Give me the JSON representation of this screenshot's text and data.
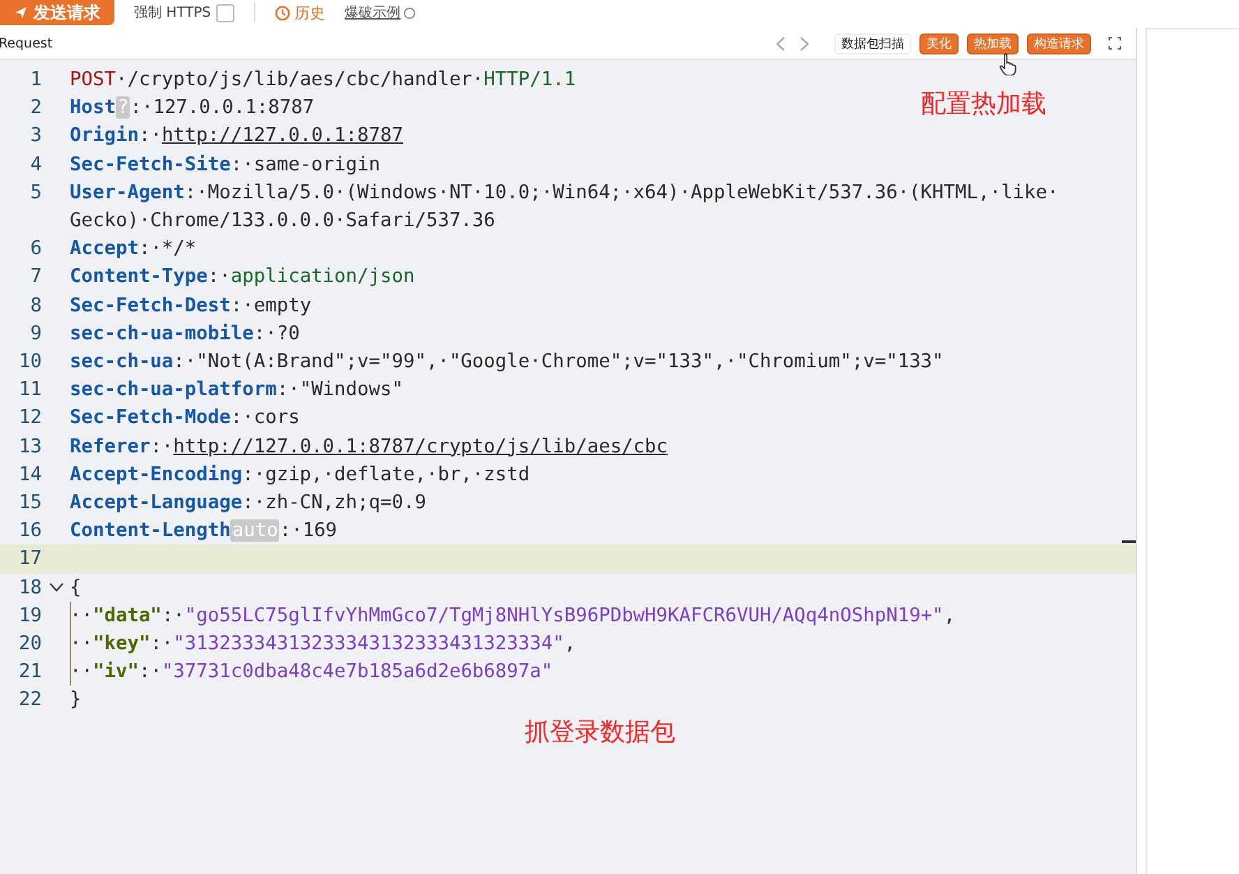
{
  "top_toolbar": {
    "send_button": "发送请求",
    "force_https": {
      "label": "强制 HTTPS",
      "checked": false
    },
    "history": "历史",
    "example_link": "爆破示例"
  },
  "panel_title": "Request",
  "toolbar_buttons": [
    {
      "label": "数据包扫描",
      "kind": "plain"
    },
    {
      "label": "美化",
      "kind": "accent"
    },
    {
      "label": "热加载",
      "kind": "accent"
    },
    {
      "label": "构造请求",
      "kind": "accent"
    }
  ],
  "lines": [
    {
      "number": "1",
      "current": false,
      "foldable": false,
      "guide": false,
      "tokens": [
        {
          "kind": "method",
          "text": "POST"
        },
        {
          "kind": "plain",
          "text": "·/crypto/js/lib/aes/cbc/handler·"
        },
        {
          "kind": "version",
          "text": "HTTP/1.1"
        }
      ]
    },
    {
      "number": "2",
      "current": false,
      "foldable": false,
      "guide": false,
      "tokens": [
        {
          "kind": "header",
          "text": "Host"
        },
        {
          "kind": "badge",
          "text": "?"
        },
        {
          "kind": "plain",
          "text": ":·127.0.0.1:8787"
        }
      ]
    },
    {
      "number": "3",
      "current": false,
      "foldable": false,
      "guide": false,
      "tokens": [
        {
          "kind": "header",
          "text": "Origin"
        },
        {
          "kind": "plain",
          "text": ":·"
        },
        {
          "kind": "url",
          "text": "http://127.0.0.1:8787"
        }
      ]
    },
    {
      "number": "4",
      "current": false,
      "foldable": false,
      "guide": false,
      "tokens": [
        {
          "kind": "header",
          "text": "Sec-Fetch-Site"
        },
        {
          "kind": "plain",
          "text": ":·same-origin"
        }
      ]
    },
    {
      "number": "5",
      "current": false,
      "foldable": false,
      "guide": false,
      "tokens": [
        {
          "kind": "header",
          "text": "User-Agent"
        },
        {
          "kind": "plain",
          "text": ":·Mozilla/5.0·(Windows·NT·10.0;·Win64;·x64)·AppleWebKit/537.36·(KHTML,·like· Gecko)·Chrome/133.0.0.0·Safari/537.36"
        }
      ]
    },
    {
      "number": "6",
      "current": false,
      "foldable": false,
      "guide": false,
      "tokens": [
        {
          "kind": "header",
          "text": "Accept"
        },
        {
          "kind": "plain",
          "text": ":·*/*"
        }
      ]
    },
    {
      "number": "7",
      "current": false,
      "foldable": false,
      "guide": false,
      "tokens": [
        {
          "kind": "header",
          "text": "Content-Type"
        },
        {
          "kind": "plain",
          "text": ":·"
        },
        {
          "kind": "version",
          "text": "application/json"
        }
      ]
    },
    {
      "number": "8",
      "current": false,
      "foldable": false,
      "guide": false,
      "tokens": [
        {
          "kind": "header",
          "text": "Sec-Fetch-Dest"
        },
        {
          "kind": "plain",
          "text": ":·empty"
        }
      ]
    },
    {
      "number": "9",
      "current": false,
      "foldable": false,
      "guide": false,
      "tokens": [
        {
          "kind": "header",
          "text": "sec-ch-ua-mobile"
        },
        {
          "kind": "plain",
          "text": ":·?0"
        }
      ]
    },
    {
      "number": "10",
      "current": false,
      "foldable": false,
      "guide": false,
      "tokens": [
        {
          "kind": "header",
          "text": "sec-ch-ua"
        },
        {
          "kind": "plain",
          "text": ":·\"Not(A:Brand\";v=\"99\",·\"Google·Chrome\";v=\"133\",·\"Chromium\";v=\"133\""
        }
      ]
    },
    {
      "number": "11",
      "current": false,
      "foldable": false,
      "guide": false,
      "tokens": [
        {
          "kind": "header",
          "text": "sec-ch-ua-platform"
        },
        {
          "kind": "plain",
          "text": ":·\"Windows\""
        }
      ]
    },
    {
      "number": "12",
      "current": false,
      "foldable": false,
      "guide": false,
      "tokens": [
        {
          "kind": "header",
          "text": "Sec-Fetch-Mode"
        },
        {
          "kind": "plain",
          "text": ":·cors"
        }
      ]
    },
    {
      "number": "13",
      "current": false,
      "foldable": false,
      "guide": false,
      "tokens": [
        {
          "kind": "header",
          "text": "Referer"
        },
        {
          "kind": "plain",
          "text": ":·"
        },
        {
          "kind": "url",
          "text": "http://127.0.0.1:8787/crypto/js/lib/aes/cbc"
        }
      ]
    },
    {
      "number": "14",
      "current": false,
      "foldable": false,
      "guide": false,
      "tokens": [
        {
          "kind": "header",
          "text": "Accept-Encoding"
        },
        {
          "kind": "plain",
          "text": ":·gzip,·deflate,·br,·zstd"
        }
      ]
    },
    {
      "number": "15",
      "current": false,
      "foldable": false,
      "guide": false,
      "tokens": [
        {
          "kind": "header",
          "text": "Accept-Language"
        },
        {
          "kind": "plain",
          "text": ":·zh-CN,zh;q=0.9"
        }
      ]
    },
    {
      "number": "16",
      "current": false,
      "foldable": false,
      "guide": false,
      "tokens": [
        {
          "kind": "header",
          "text": "Content-Length"
        },
        {
          "kind": "badge",
          "text": "auto"
        },
        {
          "kind": "plain",
          "text": ":·169"
        }
      ]
    },
    {
      "number": "17",
      "current": true,
      "foldable": false,
      "guide": false
    },
    {
      "number": "18",
      "current": false,
      "foldable": true,
      "guide": false,
      "tokens": [
        {
          "kind": "plain",
          "text": "{"
        }
      ]
    },
    {
      "number": "19",
      "current": false,
      "foldable": false,
      "guide": true,
      "tokens": [
        {
          "kind": "plain",
          "text": "··"
        },
        {
          "kind": "jkey",
          "text": "\"data\""
        },
        {
          "kind": "plain",
          "text": ":·"
        },
        {
          "kind": "jstr",
          "text": "\"go55LC75glIfvYhMmGco7/TgMj8NHlYsB96PDbwH9KAFCR6VUH/AQq4nOShpN19+\""
        },
        {
          "kind": "plain",
          "text": ","
        }
      ]
    },
    {
      "number": "20",
      "current": false,
      "foldable": false,
      "guide": true,
      "tokens": [
        {
          "kind": "plain",
          "text": "··"
        },
        {
          "kind": "jkey",
          "text": "\"key\""
        },
        {
          "kind": "plain",
          "text": ":·"
        },
        {
          "kind": "jstr",
          "text": "\"31323334313233343132333431323334\""
        },
        {
          "kind": "plain",
          "text": ","
        }
      ]
    },
    {
      "number": "21",
      "current": false,
      "foldable": false,
      "guide": true,
      "tokens": [
        {
          "kind": "plain",
          "text": "··"
        },
        {
          "kind": "jkey",
          "text": "\"iv\""
        },
        {
          "kind": "plain",
          "text": ":·"
        },
        {
          "kind": "jstr",
          "text": "\"37731c0dba48c4e7b185a6d2e6b6897a\""
        }
      ]
    },
    {
      "number": "22",
      "current": false,
      "foldable": false,
      "guide": false,
      "tokens": [
        {
          "kind": "plain",
          "text": "}"
        }
      ]
    }
  ],
  "annotations": [
    "配置热加载",
    "抓登录数据包"
  ]
}
